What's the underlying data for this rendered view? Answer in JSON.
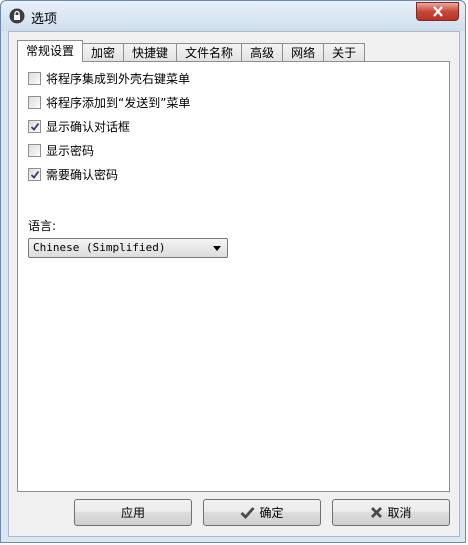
{
  "window": {
    "title": "选项"
  },
  "tabs": [
    "常规设置",
    "加密",
    "快捷键",
    "文件名称",
    "高级",
    "网络",
    "关于"
  ],
  "active_tab": "常规设置",
  "options": [
    {
      "label": "将程序集成到外壳右键菜单",
      "checked": false
    },
    {
      "label": "将程序添加到“发送到”菜单",
      "checked": false
    },
    {
      "label": "显示确认对话框",
      "checked": true
    },
    {
      "label": "显示密码",
      "checked": false
    },
    {
      "label": "需要确认密码",
      "checked": true
    }
  ],
  "language": {
    "label": "语言:",
    "selected": "Chinese (Simplified)"
  },
  "buttons": {
    "apply": "应用",
    "ok": "确定",
    "cancel": "取消"
  }
}
